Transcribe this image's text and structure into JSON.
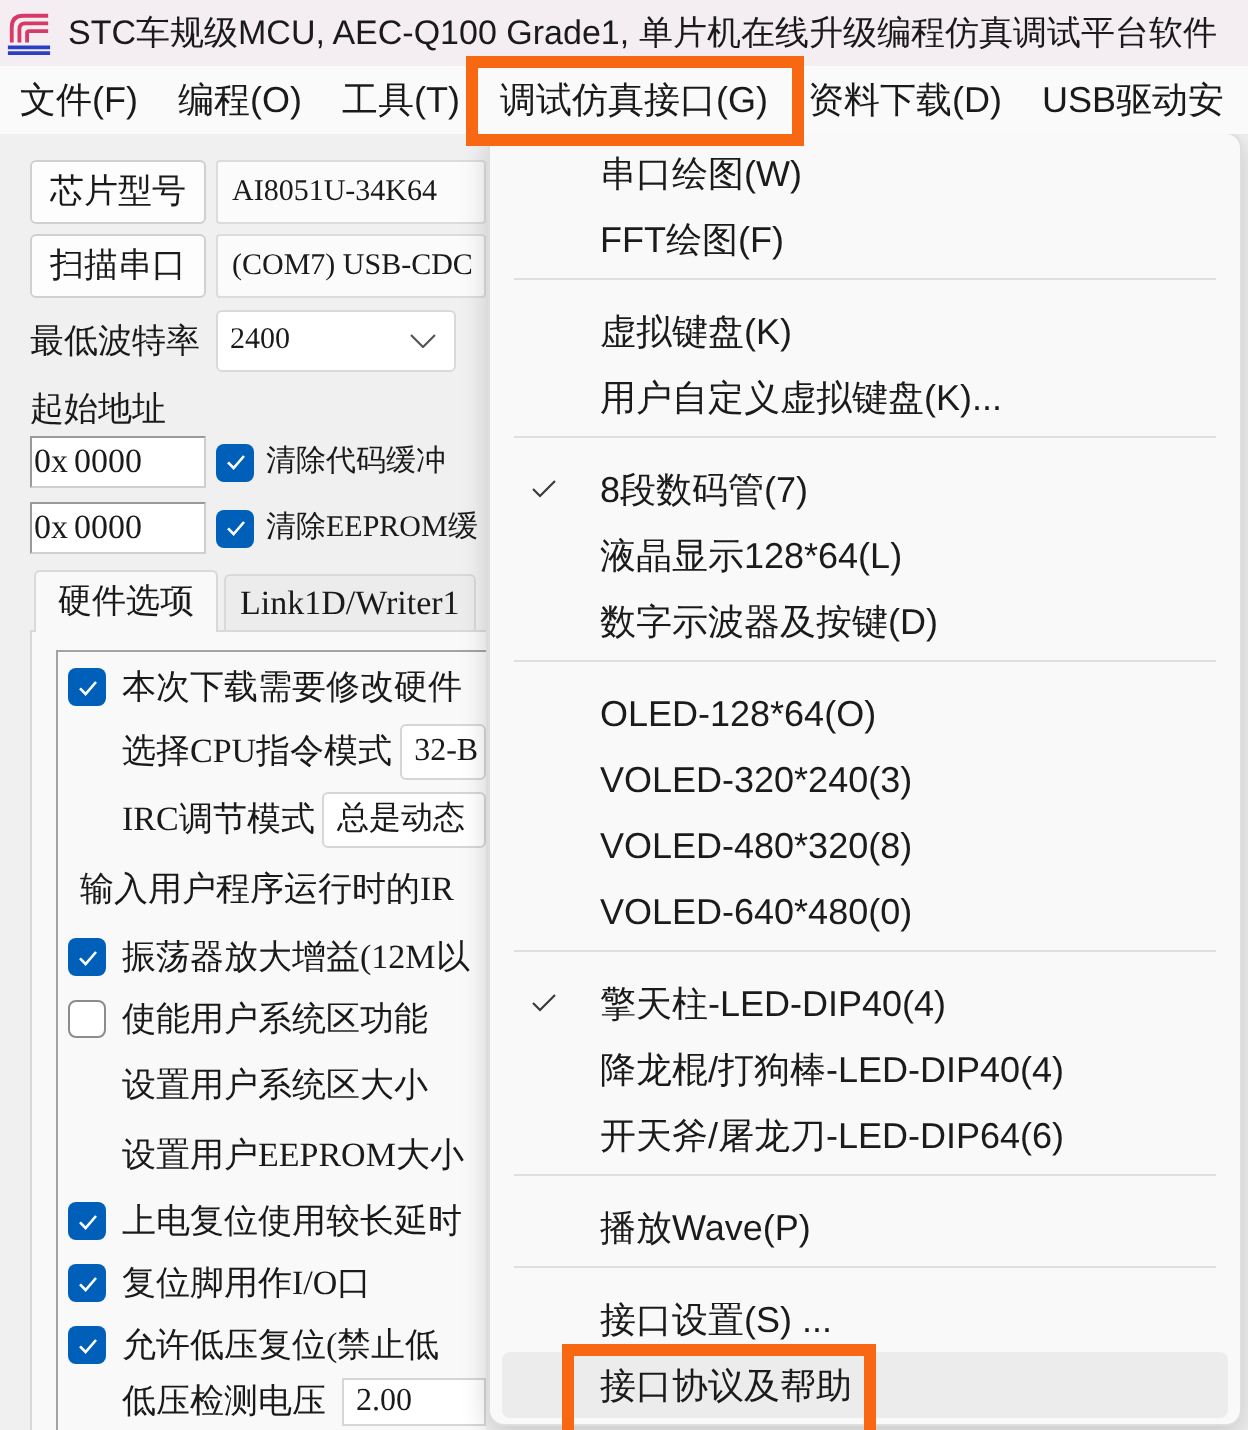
{
  "window": {
    "title": "STC车规级MCU, AEC-Q100 Grade1, 单片机在线升级编程仿真调试平台软件"
  },
  "menu_bar": [
    {
      "label": "文件(F)",
      "highlighted": false
    },
    {
      "label": "编程(O)",
      "highlighted": false
    },
    {
      "label": "工具(T)",
      "highlighted": false
    },
    {
      "label": "调试仿真接口(G)",
      "highlighted": true
    },
    {
      "label": "资料下载(D)",
      "highlighted": false
    },
    {
      "label": "USB驱动安",
      "highlighted": false
    }
  ],
  "chip": {
    "button": "芯片型号",
    "value": "AI8051U-34K64"
  },
  "port": {
    "button": "扫描串口",
    "value": "(COM7) USB-CDC"
  },
  "baud": {
    "label": "最低波特率",
    "value": "2400"
  },
  "start_address": {
    "label": "起始地址",
    "rows": [
      {
        "prefix": "0x",
        "value": "0000",
        "option": "清除代码缓冲",
        "checked": true
      },
      {
        "prefix": "0x",
        "value": "0000",
        "option": "清除EEPROM缓",
        "checked": true
      }
    ]
  },
  "tabs": [
    {
      "label": "硬件选项",
      "selected": true
    },
    {
      "label": "Link1D/Writer1",
      "selected": false
    }
  ],
  "hardware_options": [
    {
      "kind": "checkbox",
      "label": "本次下载需要修改硬件",
      "checked": true
    },
    {
      "kind": "select",
      "label": "选择CPU指令模式",
      "value": "32-B"
    },
    {
      "kind": "select",
      "label": "IRC调节模式",
      "value": "总是动态"
    },
    {
      "kind": "prompt",
      "label": "输入用户程序运行时的IR"
    },
    {
      "kind": "checkbox",
      "label": "振荡器放大增益(12M以",
      "checked": true
    },
    {
      "kind": "checkbox",
      "label": "使能用户系统区功能",
      "checked": false
    },
    {
      "kind": "label",
      "label": "设置用户系统区大小"
    },
    {
      "kind": "label",
      "label": "设置用户EEPROM大小"
    },
    {
      "kind": "checkbox",
      "label": "上电复位使用较长延时",
      "checked": true
    },
    {
      "kind": "checkbox",
      "label": "复位脚用作I/O口",
      "checked": true
    },
    {
      "kind": "checkbox",
      "label": "允许低压复位(禁止低",
      "checked": true
    },
    {
      "kind": "field",
      "label": "低压检测电压",
      "value": "2.00"
    }
  ],
  "dropdown": {
    "items": [
      {
        "kind": "item",
        "label": "串口绘图(W)",
        "checked": false,
        "hovered": false,
        "highlighted": false
      },
      {
        "kind": "item",
        "label": "FFT绘图(F)",
        "checked": false,
        "hovered": false,
        "highlighted": false
      },
      {
        "kind": "separator"
      },
      {
        "kind": "item",
        "label": "虚拟键盘(K)",
        "checked": false,
        "hovered": false,
        "highlighted": false
      },
      {
        "kind": "item",
        "label": "用户自定义虚拟键盘(K)...",
        "checked": false,
        "hovered": false,
        "highlighted": false
      },
      {
        "kind": "separator"
      },
      {
        "kind": "item",
        "label": "8段数码管(7)",
        "checked": true,
        "hovered": false,
        "highlighted": false
      },
      {
        "kind": "item",
        "label": "液晶显示128*64(L)",
        "checked": false,
        "hovered": false,
        "highlighted": false
      },
      {
        "kind": "item",
        "label": "数字示波器及按键(D)",
        "checked": false,
        "hovered": false,
        "highlighted": false
      },
      {
        "kind": "separator"
      },
      {
        "kind": "item",
        "label": "OLED-128*64(O)",
        "checked": false,
        "hovered": false,
        "highlighted": false
      },
      {
        "kind": "item",
        "label": "VOLED-320*240(3)",
        "checked": false,
        "hovered": false,
        "highlighted": false
      },
      {
        "kind": "item",
        "label": "VOLED-480*320(8)",
        "checked": false,
        "hovered": false,
        "highlighted": false
      },
      {
        "kind": "item",
        "label": "VOLED-640*480(0)",
        "checked": false,
        "hovered": false,
        "highlighted": false
      },
      {
        "kind": "separator"
      },
      {
        "kind": "item",
        "label": "擎天柱-LED-DIP40(4)",
        "checked": true,
        "hovered": false,
        "highlighted": false
      },
      {
        "kind": "item",
        "label": "降龙棍/打狗棒-LED-DIP40(4)",
        "checked": false,
        "hovered": false,
        "highlighted": false
      },
      {
        "kind": "item",
        "label": "开天斧/屠龙刀-LED-DIP64(6)",
        "checked": false,
        "hovered": false,
        "highlighted": false
      },
      {
        "kind": "separator"
      },
      {
        "kind": "item",
        "label": "播放Wave(P)",
        "checked": false,
        "hovered": false,
        "highlighted": false
      },
      {
        "kind": "separator"
      },
      {
        "kind": "item",
        "label": "接口设置(S) ...",
        "checked": false,
        "hovered": false,
        "highlighted": false
      },
      {
        "kind": "item",
        "label": "接口协议及帮助",
        "checked": false,
        "hovered": true,
        "highlighted": true
      }
    ]
  }
}
